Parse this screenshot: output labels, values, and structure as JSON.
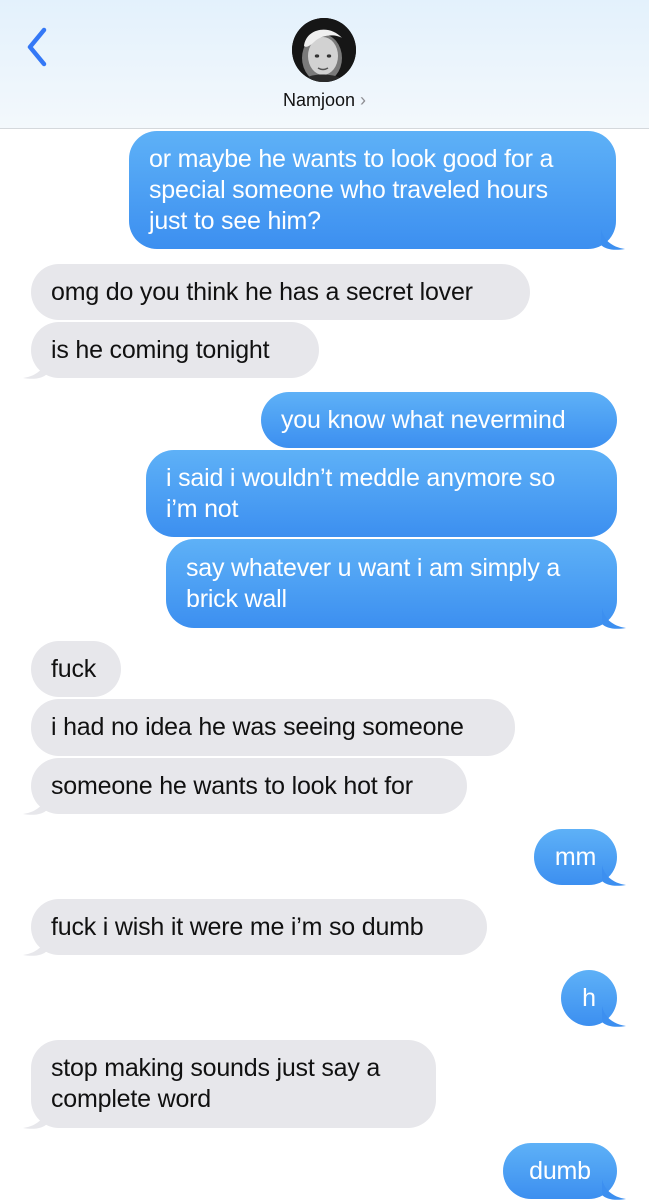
{
  "header": {
    "contact_name": "Namjoon",
    "chevron": "›",
    "back_icon": "chevron-left-icon",
    "avatar": "contact-avatar-photo"
  },
  "colors": {
    "sent_bubble": "#4a9ff3",
    "received_bubble": "#e7e7eb",
    "accent": "#3478f6"
  },
  "messages": [
    {
      "from": "me",
      "lines": [
        "or maybe he wants to look good for a",
        "special someone who traveled hours",
        "just to see him?"
      ]
    },
    {
      "from": "them",
      "lines": [
        "omg do you think he has a secret lover"
      ]
    },
    {
      "from": "them",
      "lines": [
        "is he coming tonight"
      ]
    },
    {
      "from": "me",
      "lines": [
        "you know what nevermind"
      ]
    },
    {
      "from": "me",
      "lines": [
        "i said i wouldn’t meddle anymore so",
        "i’m not"
      ]
    },
    {
      "from": "me",
      "lines": [
        "say whatever u want i am simply a",
        "brick wall"
      ]
    },
    {
      "from": "them",
      "lines": [
        "fuck"
      ]
    },
    {
      "from": "them",
      "lines": [
        "i had no idea he was seeing someone"
      ]
    },
    {
      "from": "them",
      "lines": [
        "someone he wants to look hot for"
      ]
    },
    {
      "from": "me",
      "lines": [
        "mm"
      ]
    },
    {
      "from": "them",
      "lines": [
        "fuck i wish it were me i’m so dumb"
      ]
    },
    {
      "from": "me",
      "lines": [
        "h"
      ]
    },
    {
      "from": "them",
      "lines": [
        "stop making sounds just say a",
        "complete word"
      ]
    },
    {
      "from": "me",
      "lines": [
        "dumb"
      ]
    }
  ]
}
